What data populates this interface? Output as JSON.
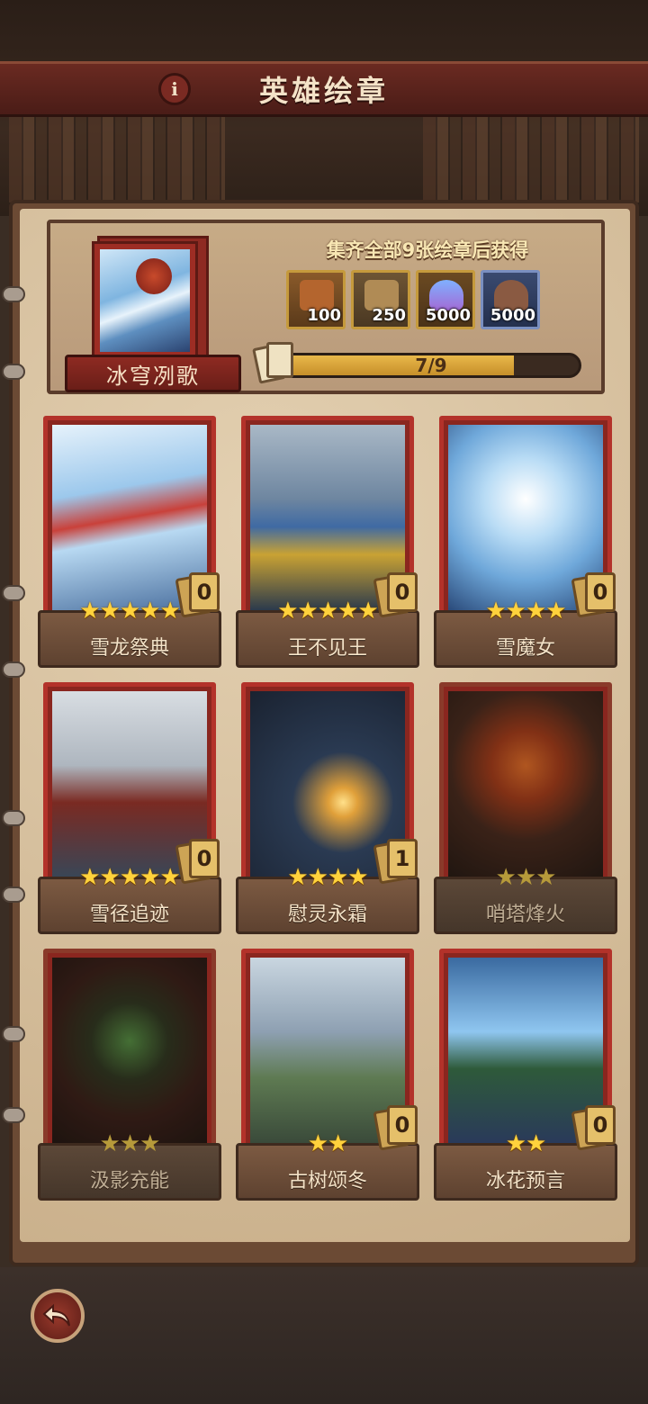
{
  "header": {
    "title": "英雄绘章",
    "info_icon": "info-icon"
  },
  "set": {
    "name": "冰穹冽歌",
    "caption": "集齐全部9张绘章后获得",
    "progress_text": "7/9",
    "progress_fraction": 0.78,
    "rewards": [
      {
        "icon": "scroll-token-icon",
        "qty": "100"
      },
      {
        "icon": "parchment-scroll-icon",
        "qty": "250"
      },
      {
        "icon": "potion-bottle-icon",
        "qty": "5000"
      },
      {
        "icon": "ore-pile-icon",
        "qty": "5000"
      }
    ]
  },
  "cards": [
    {
      "name": "雪龙祭典",
      "stars": "★★★★★",
      "count": "0",
      "locked": false
    },
    {
      "name": "王不见王",
      "stars": "★★★★★",
      "count": "0",
      "locked": false
    },
    {
      "name": "雪魔女",
      "stars": "★★★★",
      "count": "0",
      "locked": false
    },
    {
      "name": "雪径追迹",
      "stars": "★★★★★",
      "count": "0",
      "locked": false
    },
    {
      "name": "慰灵永霜",
      "stars": "★★★★",
      "count": "1",
      "locked": false
    },
    {
      "name": "哨塔烽火",
      "stars": "★★★",
      "count": "",
      "locked": true
    },
    {
      "name": "汲影充能",
      "stars": "★★★",
      "count": "",
      "locked": true
    },
    {
      "name": "古树颂冬",
      "stars": "★★",
      "count": "0",
      "locked": false
    },
    {
      "name": "冰花预言",
      "stars": "★★",
      "count": "0",
      "locked": false
    }
  ],
  "footer": {
    "back_icon": "back-arrow-icon"
  }
}
